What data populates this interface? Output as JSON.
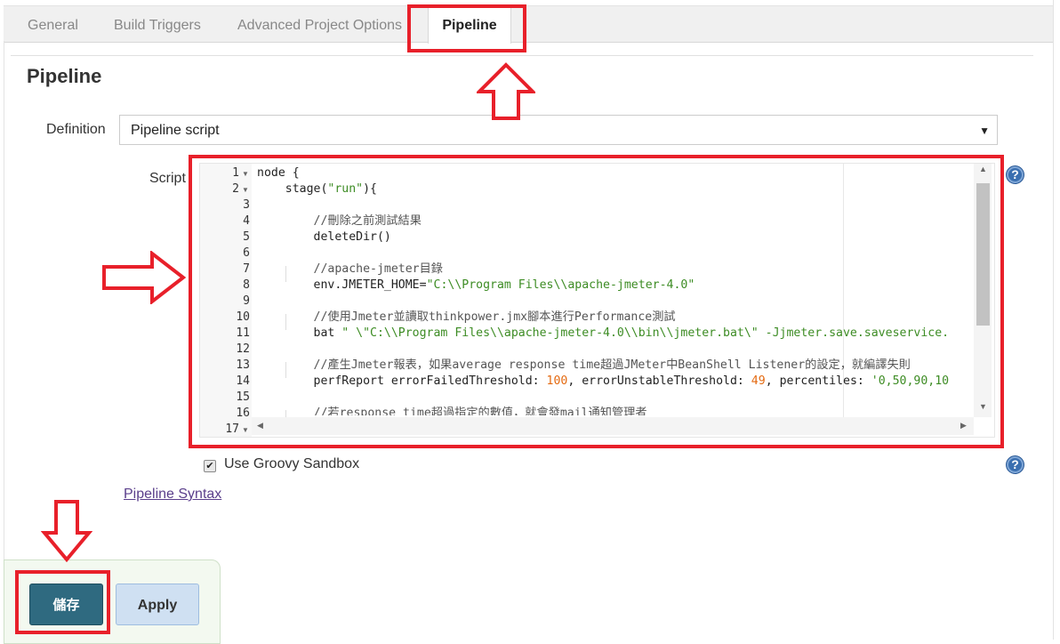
{
  "tabs": [
    {
      "label": "General"
    },
    {
      "label": "Build Triggers"
    },
    {
      "label": "Advanced Project Options"
    },
    {
      "label": "Pipeline"
    }
  ],
  "section_title": "Pipeline",
  "definition": {
    "label": "Definition",
    "selected": "Pipeline script",
    "caret": "▼"
  },
  "script": {
    "label": "Script",
    "lines": [
      {
        "num": "1",
        "text": "node {"
      },
      {
        "num": "2",
        "text": "    stage(\"run\"){"
      },
      {
        "num": "3",
        "text": ""
      },
      {
        "num": "4",
        "text": "        //刪除之前測試結果"
      },
      {
        "num": "5",
        "text": "        deleteDir()"
      },
      {
        "num": "6",
        "text": ""
      },
      {
        "num": "7",
        "text": "        //apache-jmeter目錄"
      },
      {
        "num": "8",
        "text": "        env.JMETER_HOME=\"C:\\\\Program Files\\\\apache-jmeter-4.0\""
      },
      {
        "num": "9",
        "text": ""
      },
      {
        "num": "10",
        "text": "        //使用Jmeter並讀取thinkpower.jmx腳本進行Performance測試"
      },
      {
        "num": "11",
        "text": "        bat \" \\\"C:\\\\Program Files\\\\apache-jmeter-4.0\\\\bin\\\\jmeter.bat\\\" -Jjmeter.save.saveservice."
      },
      {
        "num": "12",
        "text": ""
      },
      {
        "num": "13",
        "text": "        //產生Jmeter報表，如果average response time超過JMeter中BeanShell Listener的設定，就編譯失則"
      },
      {
        "num": "14",
        "text": "        perfReport errorFailedThreshold: 100, errorUnstableThreshold: 49, percentiles: '0,50,90,10"
      },
      {
        "num": "15",
        "text": ""
      },
      {
        "num": "16",
        "text": "        //若response time超過指定的數值，就會發mail通知管理者"
      },
      {
        "num": "17",
        "text": ""
      }
    ]
  },
  "sandbox": {
    "label": "Use Groovy Sandbox",
    "checked": true,
    "check_glyph": "✔"
  },
  "pipeline_syntax_link": "Pipeline Syntax",
  "buttons": {
    "save": "儲存",
    "apply": "Apply"
  },
  "help_glyph": "?",
  "colors": {
    "annotation_red": "#e8202a",
    "save_button": "#2f6a80",
    "apply_button": "#cfe0f2"
  }
}
